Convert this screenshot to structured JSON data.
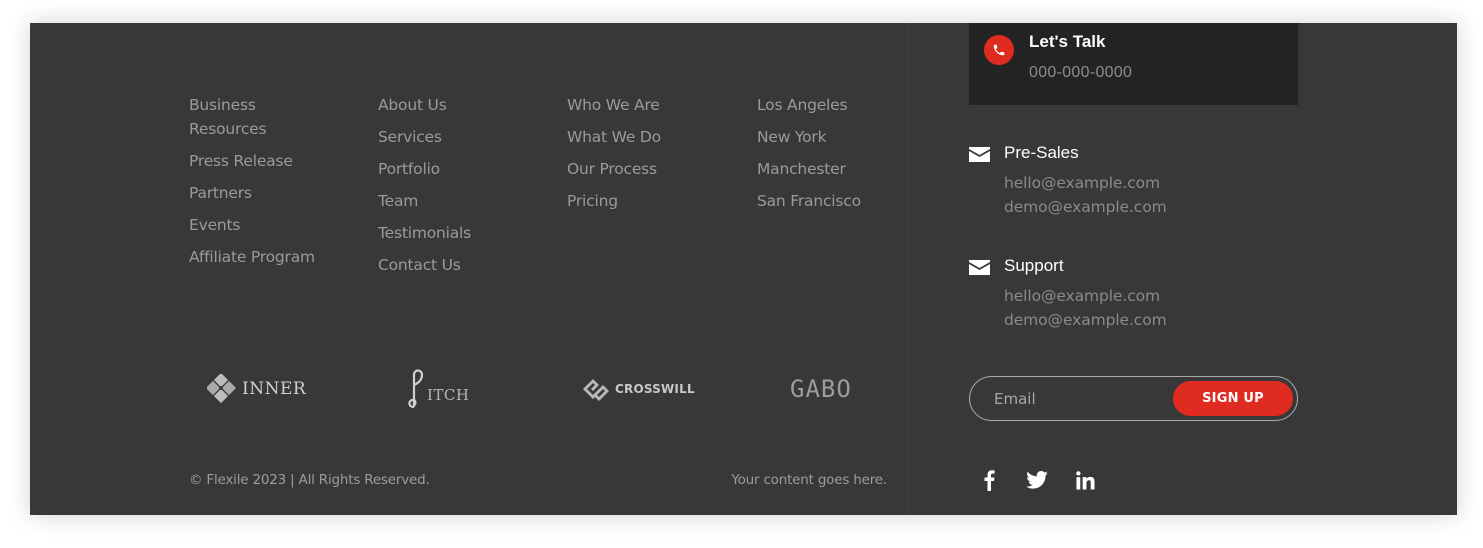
{
  "columns": [
    {
      "links": [
        "Business Resources",
        "Press Release",
        "Partners",
        "Events",
        "Affiliate Program"
      ]
    },
    {
      "links": [
        "About Us",
        "Services",
        "Portfolio",
        "Team",
        "Testimonials",
        "Contact Us"
      ]
    },
    {
      "links": [
        "Who We Are",
        "What We Do",
        "Our Process",
        "Pricing"
      ]
    },
    {
      "links": [
        "Los Angeles",
        "New York",
        "Manchester",
        "San Francisco"
      ]
    }
  ],
  "logos": {
    "inner": "INNER",
    "pitch": "ITCH",
    "crosswill": "CROSSWILL",
    "gabo": "GABO"
  },
  "bottom": {
    "copyright": "© Flexile 2023 | All Rights Reserved.",
    "tagline": "Your content goes here."
  },
  "talk": {
    "title": "Let's Talk",
    "phone": "000-000-0000",
    "icon": "phone-icon"
  },
  "contacts": [
    {
      "title": "Pre-Sales",
      "lines": [
        "hello@example.com",
        "demo@example.com"
      ],
      "icon": "mail-icon"
    },
    {
      "title": "Support",
      "lines": [
        "hello@example.com",
        "demo@example.com"
      ],
      "icon": "mail-icon"
    }
  ],
  "newsletter": {
    "placeholder": "Email",
    "button_label": "SIGN UP"
  },
  "social": [
    "facebook-icon",
    "twitter-icon",
    "linkedin-icon"
  ],
  "colors": {
    "background": "#383838",
    "accent": "#e02b20",
    "box": "#232323"
  }
}
